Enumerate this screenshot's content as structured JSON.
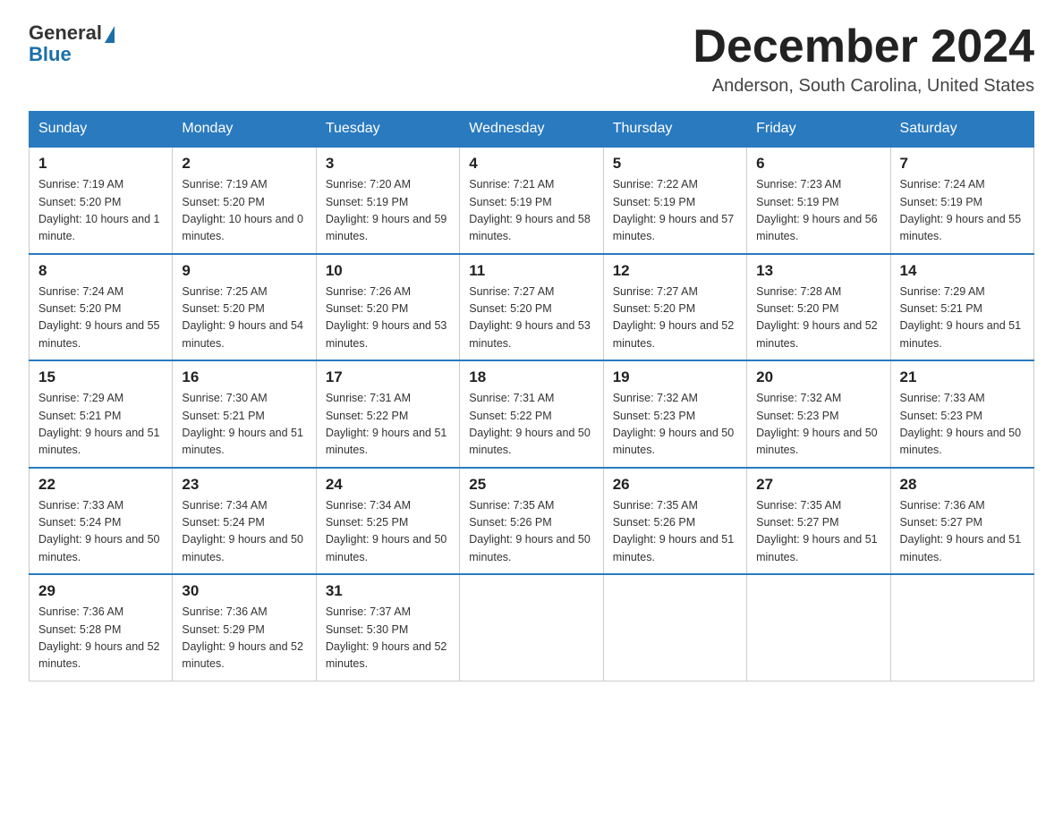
{
  "logo": {
    "word1": "General",
    "word2": "Blue"
  },
  "title": "December 2024",
  "location": "Anderson, South Carolina, United States",
  "days_of_week": [
    "Sunday",
    "Monday",
    "Tuesday",
    "Wednesday",
    "Thursday",
    "Friday",
    "Saturday"
  ],
  "weeks": [
    [
      {
        "date": "1",
        "sunrise": "7:19 AM",
        "sunset": "5:20 PM",
        "daylight": "10 hours and 1 minute."
      },
      {
        "date": "2",
        "sunrise": "7:19 AM",
        "sunset": "5:20 PM",
        "daylight": "10 hours and 0 minutes."
      },
      {
        "date": "3",
        "sunrise": "7:20 AM",
        "sunset": "5:19 PM",
        "daylight": "9 hours and 59 minutes."
      },
      {
        "date": "4",
        "sunrise": "7:21 AM",
        "sunset": "5:19 PM",
        "daylight": "9 hours and 58 minutes."
      },
      {
        "date": "5",
        "sunrise": "7:22 AM",
        "sunset": "5:19 PM",
        "daylight": "9 hours and 57 minutes."
      },
      {
        "date": "6",
        "sunrise": "7:23 AM",
        "sunset": "5:19 PM",
        "daylight": "9 hours and 56 minutes."
      },
      {
        "date": "7",
        "sunrise": "7:24 AM",
        "sunset": "5:19 PM",
        "daylight": "9 hours and 55 minutes."
      }
    ],
    [
      {
        "date": "8",
        "sunrise": "7:24 AM",
        "sunset": "5:20 PM",
        "daylight": "9 hours and 55 minutes."
      },
      {
        "date": "9",
        "sunrise": "7:25 AM",
        "sunset": "5:20 PM",
        "daylight": "9 hours and 54 minutes."
      },
      {
        "date": "10",
        "sunrise": "7:26 AM",
        "sunset": "5:20 PM",
        "daylight": "9 hours and 53 minutes."
      },
      {
        "date": "11",
        "sunrise": "7:27 AM",
        "sunset": "5:20 PM",
        "daylight": "9 hours and 53 minutes."
      },
      {
        "date": "12",
        "sunrise": "7:27 AM",
        "sunset": "5:20 PM",
        "daylight": "9 hours and 52 minutes."
      },
      {
        "date": "13",
        "sunrise": "7:28 AM",
        "sunset": "5:20 PM",
        "daylight": "9 hours and 52 minutes."
      },
      {
        "date": "14",
        "sunrise": "7:29 AM",
        "sunset": "5:21 PM",
        "daylight": "9 hours and 51 minutes."
      }
    ],
    [
      {
        "date": "15",
        "sunrise": "7:29 AM",
        "sunset": "5:21 PM",
        "daylight": "9 hours and 51 minutes."
      },
      {
        "date": "16",
        "sunrise": "7:30 AM",
        "sunset": "5:21 PM",
        "daylight": "9 hours and 51 minutes."
      },
      {
        "date": "17",
        "sunrise": "7:31 AM",
        "sunset": "5:22 PM",
        "daylight": "9 hours and 51 minutes."
      },
      {
        "date": "18",
        "sunrise": "7:31 AM",
        "sunset": "5:22 PM",
        "daylight": "9 hours and 50 minutes."
      },
      {
        "date": "19",
        "sunrise": "7:32 AM",
        "sunset": "5:23 PM",
        "daylight": "9 hours and 50 minutes."
      },
      {
        "date": "20",
        "sunrise": "7:32 AM",
        "sunset": "5:23 PM",
        "daylight": "9 hours and 50 minutes."
      },
      {
        "date": "21",
        "sunrise": "7:33 AM",
        "sunset": "5:23 PM",
        "daylight": "9 hours and 50 minutes."
      }
    ],
    [
      {
        "date": "22",
        "sunrise": "7:33 AM",
        "sunset": "5:24 PM",
        "daylight": "9 hours and 50 minutes."
      },
      {
        "date": "23",
        "sunrise": "7:34 AM",
        "sunset": "5:24 PM",
        "daylight": "9 hours and 50 minutes."
      },
      {
        "date": "24",
        "sunrise": "7:34 AM",
        "sunset": "5:25 PM",
        "daylight": "9 hours and 50 minutes."
      },
      {
        "date": "25",
        "sunrise": "7:35 AM",
        "sunset": "5:26 PM",
        "daylight": "9 hours and 50 minutes."
      },
      {
        "date": "26",
        "sunrise": "7:35 AM",
        "sunset": "5:26 PM",
        "daylight": "9 hours and 51 minutes."
      },
      {
        "date": "27",
        "sunrise": "7:35 AM",
        "sunset": "5:27 PM",
        "daylight": "9 hours and 51 minutes."
      },
      {
        "date": "28",
        "sunrise": "7:36 AM",
        "sunset": "5:27 PM",
        "daylight": "9 hours and 51 minutes."
      }
    ],
    [
      {
        "date": "29",
        "sunrise": "7:36 AM",
        "sunset": "5:28 PM",
        "daylight": "9 hours and 52 minutes."
      },
      {
        "date": "30",
        "sunrise": "7:36 AM",
        "sunset": "5:29 PM",
        "daylight": "9 hours and 52 minutes."
      },
      {
        "date": "31",
        "sunrise": "7:37 AM",
        "sunset": "5:30 PM",
        "daylight": "9 hours and 52 minutes."
      },
      null,
      null,
      null,
      null
    ]
  ]
}
